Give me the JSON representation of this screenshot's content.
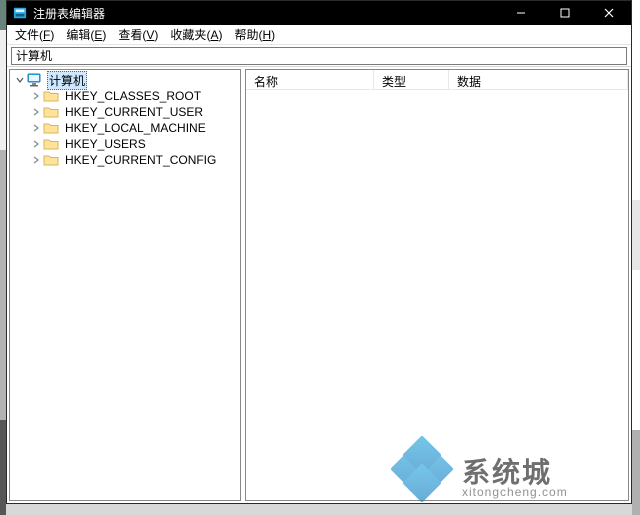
{
  "window": {
    "title": "注册表编辑器"
  },
  "menu": {
    "file": {
      "label": "文件",
      "accel": "F"
    },
    "edit": {
      "label": "编辑",
      "accel": "E"
    },
    "view": {
      "label": "查看",
      "accel": "V"
    },
    "fav": {
      "label": "收藏夹",
      "accel": "A"
    },
    "help": {
      "label": "帮助",
      "accel": "H"
    }
  },
  "addressbar": {
    "value": "计算机"
  },
  "tree": {
    "root_label": "计算机",
    "hives": [
      "HKEY_CLASSES_ROOT",
      "HKEY_CURRENT_USER",
      "HKEY_LOCAL_MACHINE",
      "HKEY_USERS",
      "HKEY_CURRENT_CONFIG"
    ]
  },
  "columns": {
    "name": "名称",
    "type": "类型",
    "data": "数据"
  },
  "watermark": {
    "brand": "系统城",
    "url": "xitongcheng.com"
  }
}
